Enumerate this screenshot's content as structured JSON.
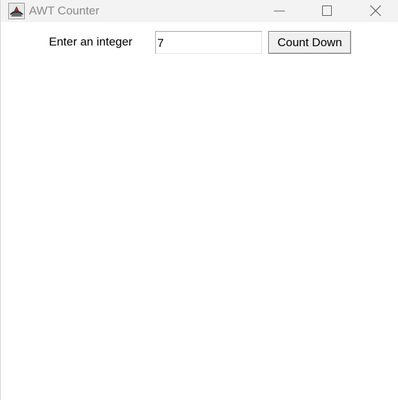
{
  "window": {
    "title": "AWT Counter",
    "icon": "java-coffee-cup-icon",
    "controls": {
      "minimize": "minimize-icon",
      "maximize": "maximize-icon",
      "close": "close-icon"
    }
  },
  "form": {
    "label": "Enter an integer",
    "input_value": "7",
    "button_label": "Count Down"
  },
  "colors": {
    "titlebar_bg": "#f3f3f3",
    "title_text": "#8a8a8a",
    "button_bg": "#f0f0f0"
  }
}
